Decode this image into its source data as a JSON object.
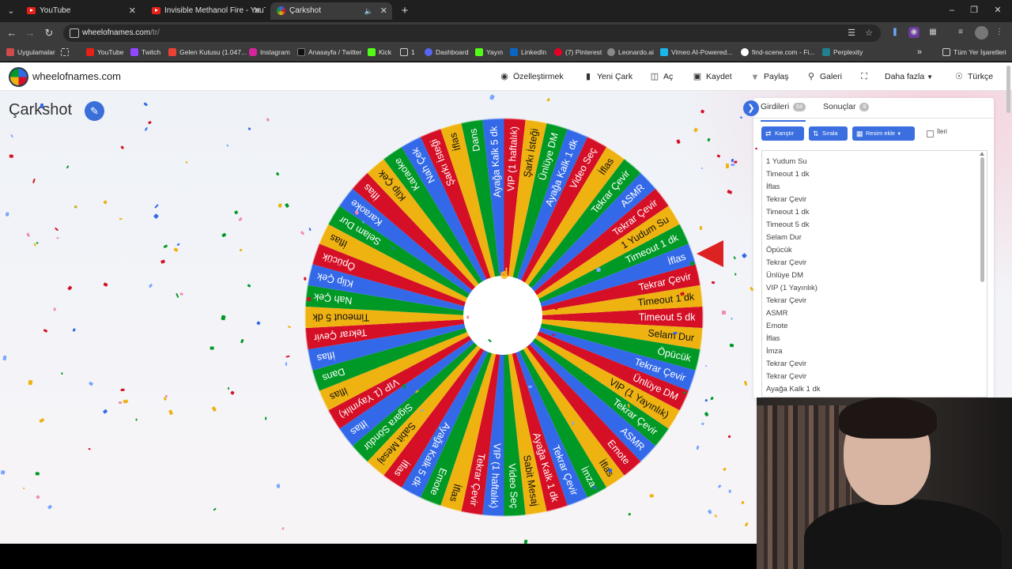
{
  "browser": {
    "tabs": [
      {
        "title": "YouTube",
        "active": false,
        "icon": "youtube-icon"
      },
      {
        "title": "Invisible Methanol Fire - YouTube",
        "active": false,
        "icon": "youtube-icon"
      },
      {
        "title": "Çarkshot",
        "active": true,
        "icon": "wheel-favicon"
      }
    ],
    "url_domain": "wheelofnames.com",
    "url_path": "/tr/",
    "bookmarks": [
      {
        "label": "Uygulamalar",
        "icon": "apps-grid-icon",
        "color": "#cf4b4b"
      },
      {
        "label": "YouTube",
        "icon": "youtube-icon",
        "color": "#e62117"
      },
      {
        "label": "Twitch",
        "icon": "twitch-icon",
        "color": "#9147ff"
      },
      {
        "label": "Gelen Kutusu (1.047...",
        "icon": "gmail-icon",
        "color": "#ea4335"
      },
      {
        "label": "Instagram",
        "icon": "instagram-icon",
        "color": "#d6249f"
      },
      {
        "label": "Anasayfa / Twitter",
        "icon": "x-icon",
        "color": "#000000"
      },
      {
        "label": "Kick",
        "icon": "kick-icon",
        "color": "#53fc18"
      },
      {
        "label": "1",
        "icon": "folder-icon",
        "color": "#cfcfcf"
      },
      {
        "label": "Dashboard",
        "icon": "dashboard-icon",
        "color": "#5865f2"
      },
      {
        "label": "Yayın",
        "icon": "kick-icon",
        "color": "#53fc18"
      },
      {
        "label": "LinkedIn",
        "icon": "linkedin-icon",
        "color": "#0a66c2"
      },
      {
        "label": "(7) Pinterest",
        "icon": "pinterest-icon",
        "color": "#e60023"
      },
      {
        "label": "Leonardo.ai",
        "icon": "leonardo-icon",
        "color": "#8a8a8a"
      },
      {
        "label": "Vimeo AI-Powered...",
        "icon": "vimeo-icon",
        "color": "#1ab7ea"
      },
      {
        "label": "find-scene.com - Fi...",
        "icon": "find-scene-icon",
        "color": "#ffffff"
      },
      {
        "label": "Perplexity",
        "icon": "perplexity-icon",
        "color": "#20808d"
      }
    ],
    "all_bookmarks": "Tüm Yer İşaretleri"
  },
  "site": {
    "brand": "wheelofnames.com",
    "menu": [
      {
        "label": "Özelleştirmek",
        "icon": "palette-icon"
      },
      {
        "label": "Yeni Çark",
        "icon": "file-icon"
      },
      {
        "label": "Aç",
        "icon": "folder-open-icon"
      },
      {
        "label": "Kaydet",
        "icon": "save-icon"
      },
      {
        "label": "Paylaş",
        "icon": "share-icon"
      },
      {
        "label": "Galeri",
        "icon": "search-icon"
      },
      {
        "label": "",
        "icon": "fullscreen-icon"
      },
      {
        "label": "Daha fazla",
        "icon": "chevron-down-icon"
      },
      {
        "label": "Türkçe",
        "icon": "globe-icon"
      }
    ],
    "wheel_title": "Çarkshot"
  },
  "wheel": {
    "colors": [
      "#d50f25",
      "#eeb211",
      "#009925",
      "#3369e8"
    ],
    "segments": [
      "Timeout 5 dk",
      "Selam Dur",
      "Öpücük",
      "Tekrar Çevir",
      "Ünlüye DM",
      "VIP (1 Yayınlık)",
      "Tekrar Çevir",
      "ASMR",
      "Emote",
      "İflas",
      "İmza",
      "Tekrar Çevir",
      "Ayağa Kalk 1 dk",
      "Sabit Mesaj",
      "Video Seç",
      "VIP (1 haftalık)",
      "Tekrar Çevir",
      "İflas",
      "Emote",
      "Ayağa Kalk 5 dk",
      "İflas",
      "Sabit Mesaj",
      "Sigara Söndür",
      "İflas",
      "VIP (1 Yayınlık)",
      "İflas",
      "Dans",
      "İflas",
      "Tekrar Çevir",
      "Timeout 5 dk",
      "Nah Çek",
      "Klip Çek",
      "Öpücük",
      "İflas",
      "Selam Dur",
      "Karaoke",
      "İflas",
      "Klip Çek",
      "Karaoke",
      "Nah Çek",
      "Şarkı İsteği",
      "İflas",
      "Dans",
      "Ayağa Kalk 5 dk",
      "VIP (1 haftalık)",
      "Şarkı İsteği",
      "Ünlüye DM",
      "Ayağa Kalk 1 dk",
      "Video Seç",
      "İflas",
      "Tekrar Çevir",
      "ASMR",
      "Tekrar Çevir",
      "1 Yudum Su",
      "Timeout 1 dk",
      "İflas",
      "Tekrar Çevir",
      "Timeout 1 dk"
    ],
    "selected_index": 0
  },
  "panel": {
    "tab_entries": "Girdileri",
    "entries_count": "64",
    "tab_results": "Sonuçlar",
    "results_count": "8",
    "btn_shuffle": "Karıştır",
    "btn_sort": "Sırala",
    "btn_add_image": "Resim ekle",
    "advanced_label": "İleri",
    "entries": [
      "1 Yudum Su",
      "Timeout 1 dk",
      "İflas",
      "Tekrar Çevir",
      "Timeout 1 dk",
      "Timeout 5 dk",
      "Selam Dur",
      "Öpücük",
      "Tekrar Çevir",
      "Ünlüye DM",
      "VIP (1 Yayınlık)",
      "Tekrar Çevir",
      "ASMR",
      "Emote",
      "İflas",
      "İmza",
      "Tekrar Çevir",
      "Tekrar Çevir",
      "Ayağa Kalk 1 dk"
    ]
  }
}
